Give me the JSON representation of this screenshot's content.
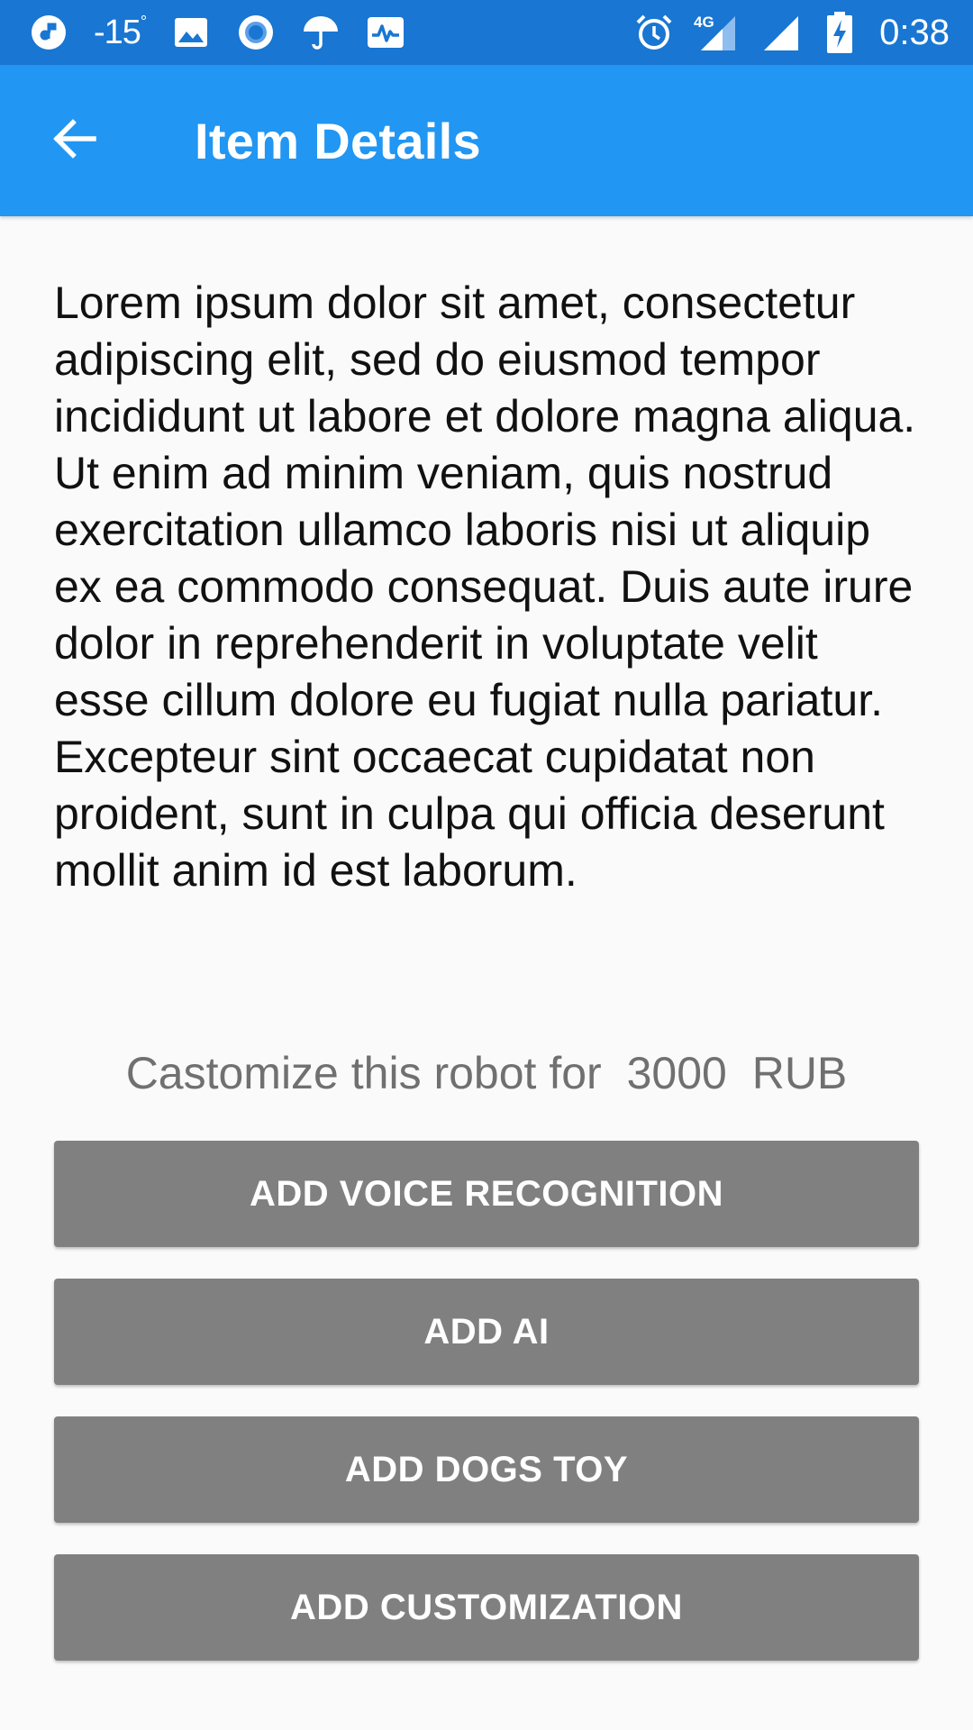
{
  "status_bar": {
    "temperature": "-15",
    "temperature_unit": "°",
    "network": "4G",
    "time": "0:38",
    "icons": [
      "music-icon",
      "image-icon",
      "circle-icon",
      "umbrella-icon",
      "activity-icon",
      "alarm-icon",
      "signal-icon",
      "signal-icon",
      "battery-charging-icon"
    ]
  },
  "app_bar": {
    "back_icon": "arrow-left-icon",
    "title": "Item Details",
    "color": "#2196f3"
  },
  "main": {
    "description": "Lorem ipsum dolor sit amet, consectetur adipiscing elit, sed do eiusmod tempor incididunt ut labore et dolore magna aliqua. Ut enim ad minim veniam, quis nostrud exercitation ullamco laboris nisi ut aliquip ex ea commodo consequat. Duis aute irure dolor in reprehenderit in voluptate velit esse cillum dolore eu fugiat nulla pariatur. Excepteur sint occaecat cupidatat non proident, sunt in culpa qui officia deserunt mollit anim id est laborum.",
    "price_prefix": "Castomize this robot for",
    "price_value": "3000",
    "price_currency": "RUB",
    "buttons": [
      {
        "label": "ADD VOICE RECOGNITION"
      },
      {
        "label": "ADD AI"
      },
      {
        "label": "ADD DOGS TOY"
      },
      {
        "label": "ADD CUSTOMIZATION"
      }
    ]
  }
}
